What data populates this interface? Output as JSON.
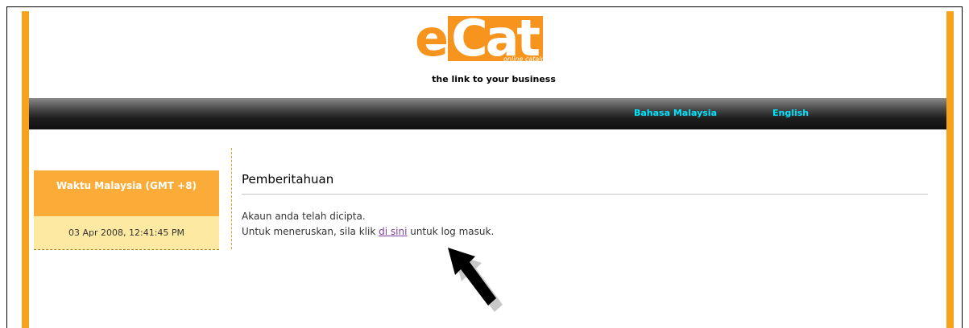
{
  "header": {
    "logo_e": "e",
    "logo_cat": "Cat",
    "logo_sub": "online catalogue system",
    "tagline": "the link to your business"
  },
  "nav": {
    "malay_label": "Bahasa Malaysia",
    "english_label": "English",
    "link_color": "#00e5ff"
  },
  "clock": {
    "title": "Waktu Malaysia (GMT +8)",
    "datetime": "03 Apr 2008, 12:41:45 PM"
  },
  "notice": {
    "title": "Pemberitahuan",
    "line1": "Akaun anda telah dicipta.",
    "line2_prefix": "Untuk meneruskan, sila klik ",
    "link_text": "di sini",
    "line2_suffix": " untuk log masuk."
  },
  "colors": {
    "accent_orange": "#f7a21b",
    "clock_header": "#fbac38",
    "clock_body": "#fde9a2"
  },
  "icons": {
    "pointer": "arrow-icon"
  }
}
